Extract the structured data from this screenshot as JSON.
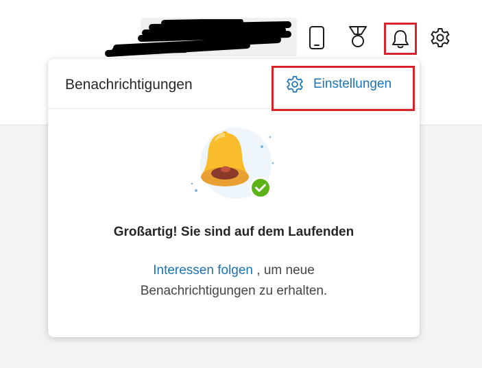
{
  "panel": {
    "title": "Benachrichtigungen",
    "settings_label": "Einstellungen",
    "headline": "Großartig! Sie sind auf dem Laufenden",
    "message_link": "Interessen folgen",
    "message_rest": ", um neue",
    "message_line2": "Benachrichtigungen zu erhalten."
  },
  "icons": {
    "phone": "phone-icon",
    "rewards": "medal-icon",
    "notifications": "bell-icon",
    "settings": "gear-icon",
    "panel_settings": "gear-icon"
  },
  "colors": {
    "accent_link": "#1a73b5",
    "highlight_red": "#d9232b",
    "check_green": "#5bb318",
    "bell_yellow": "#f9bd2c"
  }
}
